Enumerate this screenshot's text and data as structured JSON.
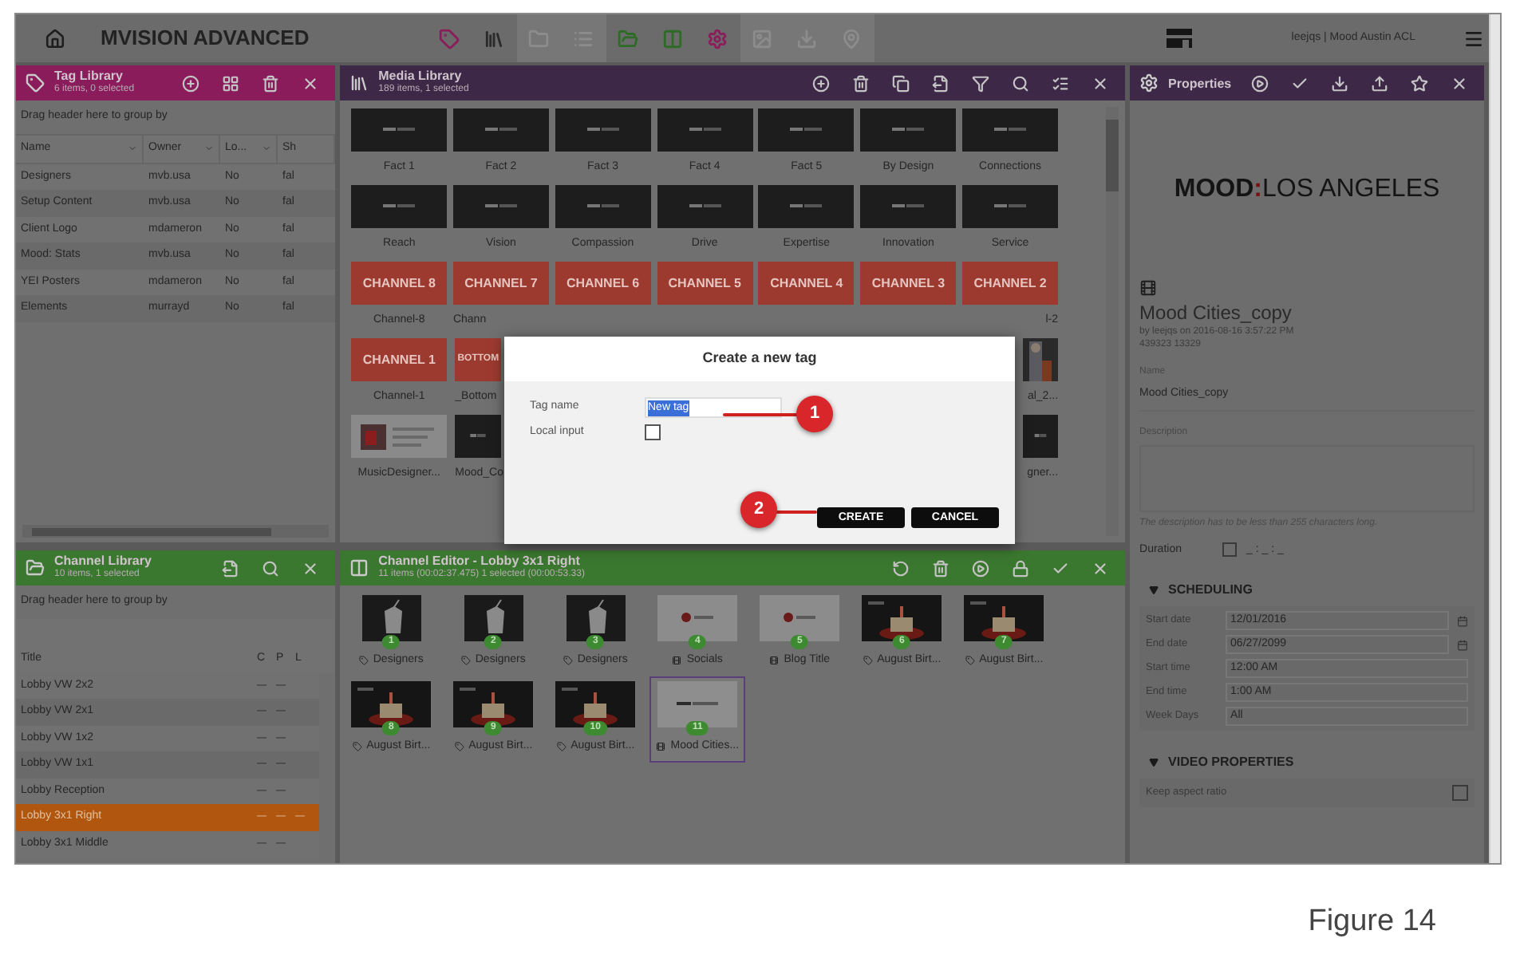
{
  "app": {
    "title": "MVISION ADVANCED",
    "user": "leejqs | Mood Austin ACL"
  },
  "tag_library": {
    "title": "Tag Library",
    "subtitle": "6 items, 0 selected",
    "group_hint": "Drag header here to group by",
    "columns": [
      "Name",
      "Owner",
      "Lo...",
      "Sh"
    ],
    "rows": [
      [
        "Designers",
        "mvb.usa",
        "No",
        "fal"
      ],
      [
        "Setup Content",
        "mvb.usa",
        "No",
        "fal"
      ],
      [
        "Client Logo",
        "mdameron",
        "No",
        "fal"
      ],
      [
        "Mood: Stats",
        "mvb.usa",
        "No",
        "fal"
      ],
      [
        "YEI Posters",
        "mdameron",
        "No",
        "fal"
      ],
      [
        "Elements",
        "murrayd",
        "No",
        "fal"
      ]
    ]
  },
  "media_library": {
    "title": "Media Library",
    "subtitle": "189 items, 1 selected",
    "rows": [
      {
        "items": [
          {
            "kind": "dark",
            "label": "Fact 1"
          },
          {
            "kind": "dark",
            "label": "Fact 2"
          },
          {
            "kind": "dark",
            "label": "Fact 3"
          },
          {
            "kind": "dark",
            "label": "Fact 4"
          },
          {
            "kind": "dark",
            "label": "Fact 5"
          },
          {
            "kind": "dark",
            "label": "By Design"
          },
          {
            "kind": "dark",
            "label": "Connections"
          }
        ]
      },
      {
        "items": [
          {
            "kind": "dark",
            "label": "Reach"
          },
          {
            "kind": "dark",
            "label": "Vision"
          },
          {
            "kind": "dark",
            "label": "Compassion"
          },
          {
            "kind": "dark",
            "label": "Drive"
          },
          {
            "kind": "dark",
            "label": "Expertise"
          },
          {
            "kind": "dark",
            "label": "Innovation"
          },
          {
            "kind": "dark",
            "label": "Service"
          }
        ]
      },
      {
        "items": [
          {
            "kind": "channel",
            "text": "CHANNEL 8",
            "label": "Channel-8"
          },
          {
            "kind": "channel",
            "text": "CHANNEL 7",
            "label": "Chann"
          },
          {
            "kind": "channel",
            "text": "CHANNEL 6"
          },
          {
            "kind": "channel",
            "text": "CHANNEL 5"
          },
          {
            "kind": "channel",
            "text": "CHANNEL 4"
          },
          {
            "kind": "channel",
            "text": "CHANNEL 3"
          },
          {
            "kind": "channel",
            "text": "CHANNEL 2",
            "label": "l-2"
          }
        ]
      },
      {
        "items": [
          {
            "kind": "channel",
            "text": "CHANNEL 1",
            "label": "Channel-1"
          },
          {
            "kind": "channel",
            "text": "BOTTOM",
            "label": "_Bottom"
          },
          {
            "label": "al_2..."
          }
        ]
      },
      {
        "items": [
          {
            "kind": "slide",
            "label": "MusicDesigner..."
          },
          {
            "kind": "dark",
            "label": "Mood_Co"
          },
          {
            "kind": "dark",
            "label": "gner..."
          }
        ]
      }
    ]
  },
  "properties": {
    "title": "Properties",
    "preview": {
      "brand": "MOOD",
      "separator": ":",
      "city": "LOS ANGELES"
    },
    "name_title": "Mood Cities_copy",
    "byline": "by leejqs on 2016-08-16 3:57:22 PM",
    "code": "439323 13329",
    "fields": [
      {
        "label": "Name",
        "value": "Mood Cities_copy"
      },
      {
        "label": "Description",
        "note": "The description has to be less than 255 characters long."
      }
    ],
    "duration": {
      "label": "Duration",
      "checked": false,
      "value": "_ : _ : _"
    },
    "sections": [
      {
        "title": "SCHEDULING",
        "expanded": true,
        "rows": [
          {
            "label": "Start date",
            "value": "12/01/2016",
            "kind": "date"
          },
          {
            "label": "End date",
            "value": "06/27/2099",
            "kind": "date"
          },
          {
            "label": "Start time",
            "value": "12:00 AM",
            "kind": "text"
          },
          {
            "label": "End time",
            "value": "1:00 AM",
            "kind": "text"
          },
          {
            "label": "Week Days",
            "value": "All",
            "kind": "text"
          }
        ]
      },
      {
        "title": "VIDEO PROPERTIES",
        "expanded": true,
        "rows": [
          {
            "label": "Keep aspect ratio",
            "kind": "check",
            "checked": false
          }
        ]
      }
    ]
  },
  "channel_library": {
    "title": "Channel Library",
    "subtitle": "10 items, 1 selected",
    "group_hint": "Drag header here to group by",
    "columns": [
      "Title",
      "C",
      "P",
      "L"
    ],
    "rows": [
      {
        "title": "Lobby VW 2x2",
        "c": "—",
        "p": "—",
        "selected": false
      },
      {
        "title": "Lobby VW 2x1",
        "c": "—",
        "p": "—",
        "selected": false
      },
      {
        "title": "Lobby VW 1x2",
        "c": "—",
        "p": "—",
        "selected": false
      },
      {
        "title": "Lobby VW 1x1",
        "c": "—",
        "p": "—",
        "selected": false
      },
      {
        "title": "Lobby Reception",
        "c": "—",
        "p": "—",
        "selected": false
      },
      {
        "title": "Lobby 3x1 Right",
        "c": "—",
        "p": "—",
        "l": "—",
        "selected": true
      },
      {
        "title": "Lobby 3x1 Middle",
        "c": "—",
        "p": "—",
        "selected": false
      }
    ]
  },
  "channel_editor": {
    "title": "Channel Editor - Lobby 3x1 Right",
    "subtitle": "11 items (00:02:37.475) 1 selected (00:00:53.33)",
    "items": [
      {
        "number": "1",
        "kind": "tag",
        "label": "Designers",
        "selected": false
      },
      {
        "number": "2",
        "kind": "tag",
        "label": "Designers",
        "selected": false
      },
      {
        "number": "3",
        "kind": "tag",
        "label": "Designers",
        "selected": false
      },
      {
        "number": "4",
        "kind": "logo",
        "label": "Socials",
        "selected": false
      },
      {
        "number": "5",
        "kind": "logo",
        "label": "Blog Title",
        "selected": false
      },
      {
        "number": "6",
        "kind": "cake",
        "label": "August Birt...",
        "selected": false
      },
      {
        "number": "7",
        "kind": "cake",
        "label": "August Birt...",
        "selected": false
      },
      {
        "number": "8",
        "kind": "cake",
        "label": "August Birt...",
        "selected": false
      },
      {
        "number": "9",
        "kind": "cake",
        "label": "August Birt...",
        "selected": false
      },
      {
        "number": "10",
        "kind": "cake",
        "label": "August Birt...",
        "selected": false
      },
      {
        "number": "11",
        "kind": "mood",
        "label": "Mood Cities...",
        "selected": true
      }
    ]
  },
  "dialog": {
    "title": "Create a new tag",
    "tag_name": {
      "label": "Tag name",
      "value": "New tag",
      "selected": true
    },
    "local_input": {
      "label": "Local input",
      "checked": false
    },
    "buttons": [
      "CREATE",
      "CANCEL"
    ]
  },
  "callouts": [
    {
      "label": "1"
    },
    {
      "label": "2"
    }
  ],
  "caption": "Figure 14"
}
